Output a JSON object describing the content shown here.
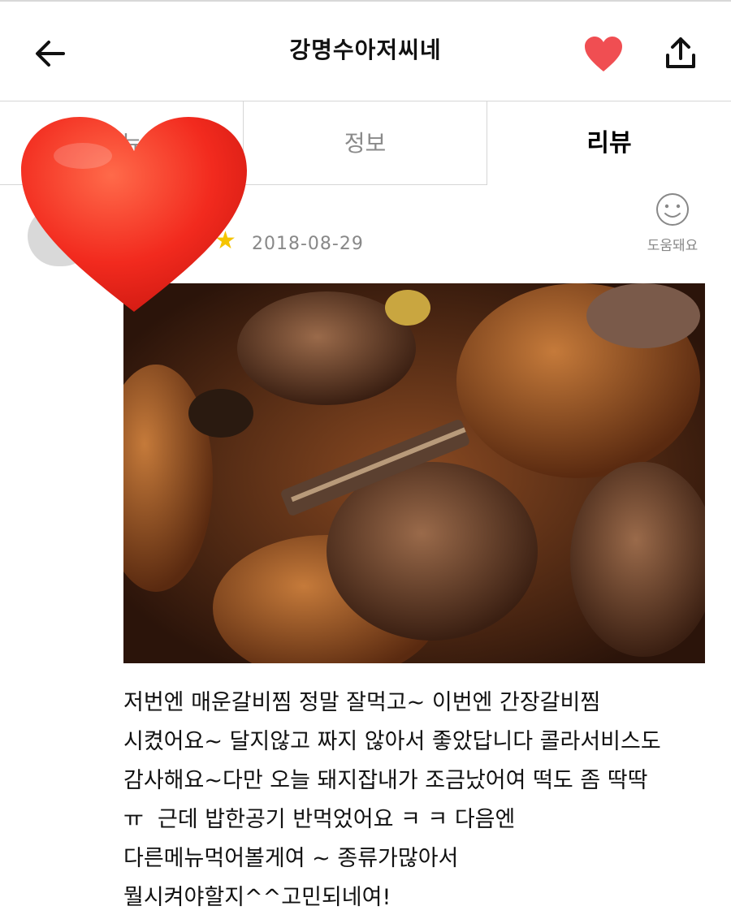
{
  "header": {
    "title": "강명수아저씨네",
    "back_icon": "arrow-left-icon",
    "favorite_icon": "heart-icon",
    "share_icon": "share-icon",
    "favorite_color": "#f04e52"
  },
  "tabs": [
    {
      "label": "메뉴",
      "active": false
    },
    {
      "label": "정보",
      "active": false
    },
    {
      "label": "리뷰",
      "active": true
    }
  ],
  "review": {
    "rating_icon": "star-icon",
    "star_glyph": "★",
    "date": "2018-08-29",
    "helpful_label": "도움돼요",
    "helpful_icon": "smiley-icon",
    "text": "저번엔 매운갈비찜 정말 잘먹고~ 이번엔 간장갈비찜\n시켰어요~ 달지않고 짜지 않아서 좋았답니다 콜라서비스도\n감사해요~다만 오늘 돼지잡내가 조금났어여 떡도 좀 딱딱\nㅠ  근데 밥한공기 반먹었어요 ㅋ ㅋ 다음엔\n다른메뉴먹어볼게여 ~ 종류가많아서\n뭘시켜야할지^^고민되네여!"
  },
  "colors": {
    "accent_heart": "#f04e52",
    "star": "#f5c400",
    "sticker_heart": "#f22a1e"
  }
}
